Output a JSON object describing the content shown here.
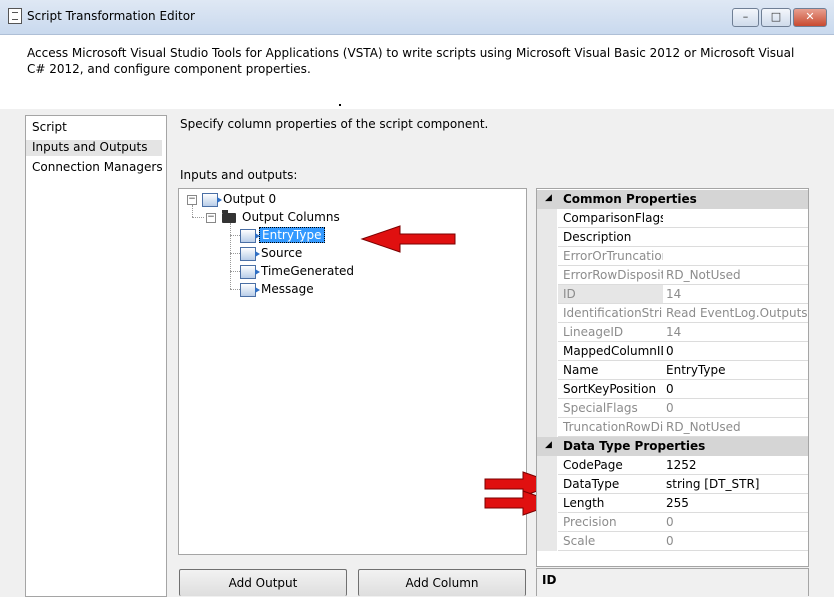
{
  "window": {
    "title": "Script Transformation Editor",
    "minimize": "–",
    "maximize": "□",
    "close": "✕"
  },
  "header": {
    "text": "Access Microsoft Visual Studio Tools for Applications (VSTA) to write scripts using Microsoft Visual Basic 2012 or Microsoft Visual C# 2012, and configure component properties."
  },
  "nav": {
    "items": [
      "Script",
      "Inputs and Outputs",
      "Connection Managers"
    ],
    "active": "Inputs and Outputs"
  },
  "main": {
    "description": "Specify column properties of the script component.",
    "io_label": "Inputs and outputs:",
    "tree": {
      "output": "Output 0",
      "output_columns": "Output Columns",
      "columns": [
        "EntryType",
        "Source",
        "TimeGenerated",
        "Message"
      ],
      "selected": "EntryType"
    },
    "buttons": {
      "add_output": "Add Output",
      "add_column": "Add Column"
    }
  },
  "properties": {
    "common_title": "Common Properties",
    "common": [
      {
        "name": "ComparisonFlags",
        "value": "",
        "dim": false
      },
      {
        "name": "Description",
        "value": "",
        "dim": false
      },
      {
        "name": "ErrorOrTruncationOperation",
        "value": "",
        "dim": true
      },
      {
        "name": "ErrorRowDisposition",
        "value": "RD_NotUsed",
        "dim": true
      },
      {
        "name": "ID",
        "value": "14",
        "dim": true
      },
      {
        "name": "IdentificationString",
        "value": "Read EventLog.Outputs[Out",
        "dim": true
      },
      {
        "name": "LineageID",
        "value": "14",
        "dim": true
      },
      {
        "name": "MappedColumnID",
        "value": "0",
        "dim": false
      },
      {
        "name": "Name",
        "value": "EntryType",
        "dim": false
      },
      {
        "name": "SortKeyPosition",
        "value": "0",
        "dim": false
      },
      {
        "name": "SpecialFlags",
        "value": "0",
        "dim": true
      },
      {
        "name": "TruncationRowDisposition",
        "value": "RD_NotUsed",
        "dim": true
      }
    ],
    "datatype_title": "Data Type Properties",
    "datatype": [
      {
        "name": "CodePage",
        "value": "1252",
        "dim": false
      },
      {
        "name": "DataType",
        "value": "string [DT_STR]",
        "dim": false
      },
      {
        "name": "Length",
        "value": "255",
        "dim": false
      },
      {
        "name": "Precision",
        "value": "0",
        "dim": true
      },
      {
        "name": "Scale",
        "value": "0",
        "dim": true
      }
    ],
    "description_title": "ID"
  },
  "colors": {
    "selection": "#3399ff",
    "annotation_arrow": "#e01010",
    "category": "#d5d5d5"
  }
}
